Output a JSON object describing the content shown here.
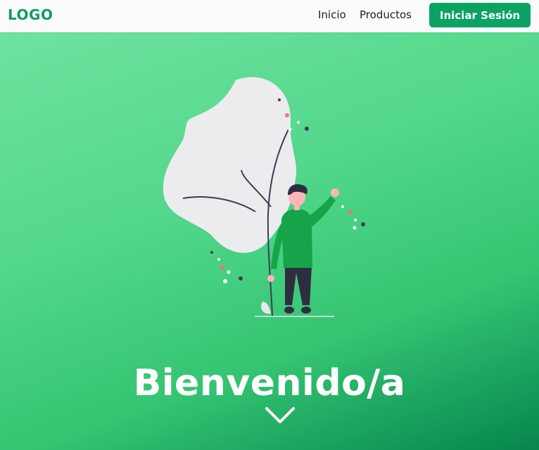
{
  "nav": {
    "logo": "LOGO",
    "links": [
      {
        "label": "Inicio"
      },
      {
        "label": "Productos"
      }
    ],
    "login_label": "Iniciar Sesión"
  },
  "hero": {
    "title": "Bienvenido/a",
    "scroll_icon": "chevron-down-icon",
    "illustration": "person-waving-with-large-leaf"
  },
  "colors": {
    "brand": "#0aa363",
    "logo": "#0f9d62",
    "hero_light": "#6ee39f",
    "hero_dark": "#06854d",
    "shirt": "#16a34a",
    "pants": "#2f2e41"
  }
}
